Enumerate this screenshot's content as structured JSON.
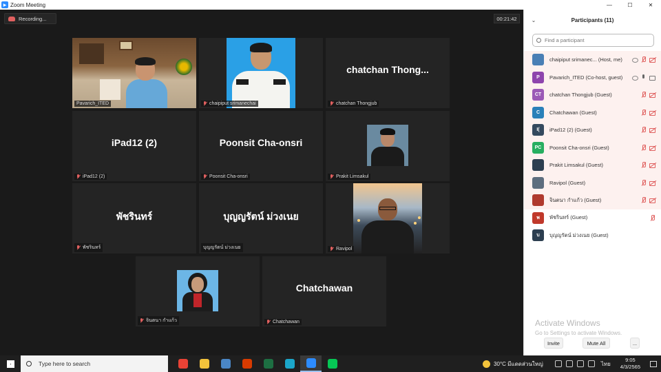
{
  "window": {
    "title": "Zoom Meeting",
    "controls": [
      "—",
      "☐",
      "✕"
    ]
  },
  "meeting": {
    "recording_label": "Recording...",
    "timer": "00:21:42",
    "tiles": [
      {
        "name": "Pavarich_ITED",
        "big_name": "",
        "muted": false,
        "video": "office",
        "active": true
      },
      {
        "name": "chaipiput srimanechai",
        "big_name": "",
        "muted": true,
        "video": "uniform",
        "active": false
      },
      {
        "name": "chatchan Thongjub",
        "big_name": "chatchan  Thong...",
        "muted": true,
        "video": "none",
        "active": false
      },
      {
        "name": "iPad12 (2)",
        "big_name": "iPad12 (2)",
        "muted": true,
        "video": "none",
        "active": false
      },
      {
        "name": "Poonsit Cha-onsri",
        "big_name": "Poonsit Cha-onsri",
        "muted": true,
        "video": "none",
        "active": false
      },
      {
        "name": "Prakit Limsakul",
        "big_name": "",
        "muted": true,
        "video": "prakit",
        "active": false
      },
      {
        "name": "พัชรินทร์",
        "big_name": "พัชรินทร์",
        "muted": true,
        "video": "none",
        "active": false
      },
      {
        "name": "บุญญรัตน์ ม่วงเนย",
        "big_name": "บุญญรัตน์  ม่วงเนย",
        "muted": false,
        "video": "none",
        "active": false
      },
      {
        "name": "Ravipol",
        "big_name": "",
        "muted": true,
        "video": "ravipol",
        "active": false
      },
      {
        "name": "จินตนา กำแก้ว",
        "big_name": "",
        "muted": true,
        "video": "woman",
        "active": false
      },
      {
        "name": "Chatchawan",
        "big_name": "Chatchawan",
        "muted": true,
        "video": "none",
        "active": false
      }
    ]
  },
  "panel": {
    "title": "Participants (11)",
    "collapse_icon": "⌄",
    "search_placeholder": "Find a participant",
    "participants": [
      {
        "name": "chaipiput srimanec... (Host, me)",
        "initials": "",
        "avatar_color": "#4a7fb5",
        "photo": true,
        "share": true,
        "mic": "muted",
        "cam": "off"
      },
      {
        "name": "Pavarich_ITED (Co-host, guest)",
        "initials": "P",
        "avatar_color": "#8e44ad",
        "photo": false,
        "share": true,
        "mic": "on",
        "cam": "on"
      },
      {
        "name": "chatchan Thongjub (Guest)",
        "initials": "CT",
        "avatar_color": "#9b59b6",
        "photo": false,
        "share": false,
        "mic": "muted",
        "cam": "off"
      },
      {
        "name": "Chatchawan (Guest)",
        "initials": "C",
        "avatar_color": "#2980b9",
        "photo": false,
        "share": false,
        "mic": "muted",
        "cam": "off"
      },
      {
        "name": "iPad12 (2) (Guest)",
        "initials": "I(",
        "avatar_color": "#34495e",
        "photo": false,
        "share": false,
        "mic": "muted",
        "cam": "off"
      },
      {
        "name": "Poonsit Cha-onsri (Guest)",
        "initials": "PC",
        "avatar_color": "#27ae60",
        "photo": false,
        "share": false,
        "mic": "muted",
        "cam": "off"
      },
      {
        "name": "Prakit Limsakul (Guest)",
        "initials": "",
        "avatar_color": "#2c3e50",
        "photo": true,
        "share": false,
        "mic": "muted",
        "cam": "off"
      },
      {
        "name": "Ravipol (Guest)",
        "initials": "",
        "avatar_color": "#5d6d7e",
        "photo": true,
        "share": false,
        "mic": "muted",
        "cam": "off"
      },
      {
        "name": "จินตนา กำแก้ว (Guest)",
        "initials": "",
        "avatar_color": "#b03a2e",
        "photo": true,
        "share": false,
        "mic": "muted",
        "cam": "off"
      },
      {
        "name": "พัชรินทร์ (Guest)",
        "initials": "พ",
        "avatar_color": "#c0392b",
        "photo": false,
        "share": false,
        "mic": "muted",
        "cam": "none"
      },
      {
        "name": "บุญญรัตน์ ม่วงเนย (Guest)",
        "initials": "บ",
        "avatar_color": "#2c3e50",
        "photo": false,
        "share": false,
        "mic": "none",
        "cam": "none"
      }
    ],
    "activate_title": "Activate Windows",
    "activate_sub": "Go to Settings to activate Windows.",
    "invite_label": "Invite",
    "mute_all_label": "Mute All",
    "more_label": "..."
  },
  "taskbar": {
    "search_placeholder": "Type here to search",
    "apps": [
      {
        "name": "chrome",
        "color": "#e94235"
      },
      {
        "name": "file-explorer",
        "color": "#f3c33b"
      },
      {
        "name": "paint",
        "color": "#4a86c5"
      },
      {
        "name": "office",
        "color": "#d83b01"
      },
      {
        "name": "excel",
        "color": "#1d6f42"
      },
      {
        "name": "edge",
        "color": "#1ba6c9"
      },
      {
        "name": "zoom",
        "color": "#2d8cff"
      },
      {
        "name": "line",
        "color": "#06c755"
      }
    ],
    "weather": "30°C  มีแดดส่วนใหญ่",
    "time": "9:05",
    "date": "4/3/2565",
    "language": "ไทย"
  }
}
